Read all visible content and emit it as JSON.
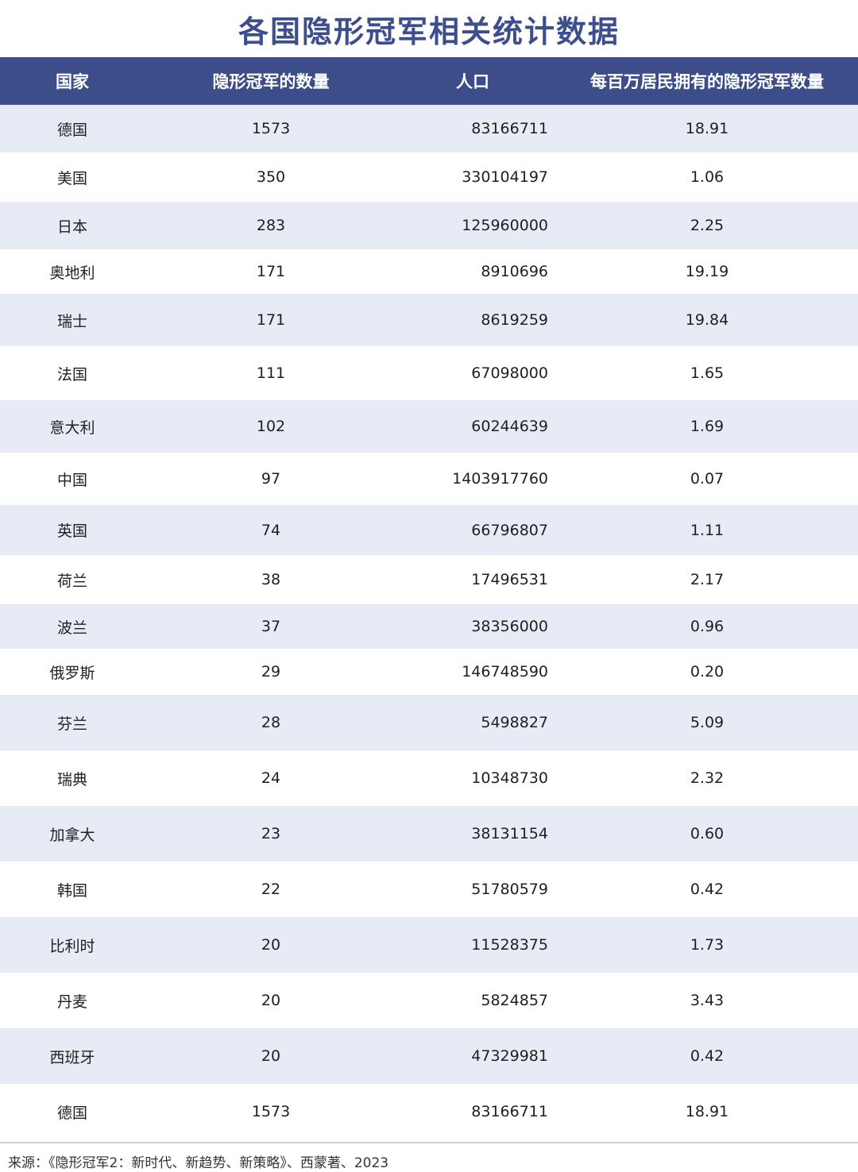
{
  "title": "各国隐形冠军相关统计数据",
  "table": {
    "headers": {
      "country": "国家",
      "count": "隐形冠军的数量",
      "population": "人口",
      "per_million": "每百万居民拥有的隐形冠军数量"
    },
    "rows": [
      {
        "country": "德国",
        "count": "1573",
        "population": "83166711",
        "per_million": "18.91"
      },
      {
        "country": "美国",
        "count": "350",
        "population": "330104197",
        "per_million": "1.06"
      },
      {
        "country": "日本",
        "count": "283",
        "population": "125960000",
        "per_million": "2.25"
      },
      {
        "country": "奥地利",
        "count": "171",
        "population": "8910696",
        "per_million": "19.19"
      },
      {
        "country": "瑞士",
        "count": "171",
        "population": "8619259",
        "per_million": "19.84"
      },
      {
        "country": "法国",
        "count": "111",
        "population": "67098000",
        "per_million": "1.65"
      },
      {
        "country": "意大利",
        "count": "102",
        "population": "60244639",
        "per_million": "1.69"
      },
      {
        "country": "中国",
        "count": "97",
        "population": "1403917760",
        "per_million": "0.07"
      },
      {
        "country": "英国",
        "count": "74",
        "population": "66796807",
        "per_million": "1.11"
      },
      {
        "country": "荷兰",
        "count": "38",
        "population": "17496531",
        "per_million": "2.17"
      },
      {
        "country": "波兰",
        "count": "37",
        "population": "38356000",
        "per_million": "0.96"
      },
      {
        "country": "俄罗斯",
        "count": "29",
        "population": "146748590",
        "per_million": "0.20"
      },
      {
        "country": "芬兰",
        "count": "28",
        "population": "5498827",
        "per_million": "5.09"
      },
      {
        "country": "瑞典",
        "count": "24",
        "population": "10348730",
        "per_million": "2.32"
      },
      {
        "country": "加拿大",
        "count": "23",
        "population": "38131154",
        "per_million": "0.60"
      },
      {
        "country": "韩国",
        "count": "22",
        "population": "51780579",
        "per_million": "0.42"
      },
      {
        "country": "比利时",
        "count": "20",
        "population": "11528375",
        "per_million": "1.73"
      },
      {
        "country": "丹麦",
        "count": "20",
        "population": "5824857",
        "per_million": "3.43"
      },
      {
        "country": "西班牙",
        "count": "20",
        "population": "47329981",
        "per_million": "0.42"
      },
      {
        "country": "德国",
        "count": "1573",
        "population": "83166711",
        "per_million": "18.91"
      }
    ]
  },
  "source": "来源：《隐形冠军2：新时代、新趋势、新策略》、西蒙著、2023",
  "colors": {
    "header_bg": "#3d4d8a",
    "title": "#3c4e8c",
    "row_stripe": "#e7ebf6"
  }
}
